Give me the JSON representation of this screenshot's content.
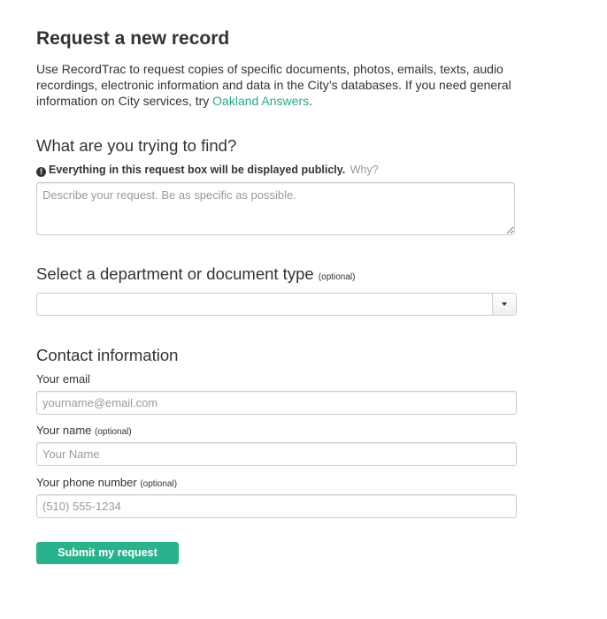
{
  "title": "Request a new record",
  "intro": {
    "text": "Use RecordTrac to request copies of specific documents, photos, emails, texts, audio recordings, electronic information and data in the City’s databases. If you need general information on City services, try ",
    "link_text": "Oakland Answers",
    "trailing": "."
  },
  "find_section": {
    "heading": "What are you trying to find?",
    "warning_icon": "!",
    "warning_text": "Everything in this request box will be displayed publicly.",
    "why_link": "Why?",
    "textarea_placeholder": "Describe your request. Be as specific as possible.",
    "textarea_value": ""
  },
  "department_section": {
    "heading": "Select a department or document type",
    "optional": "(optional)",
    "selected_value": ""
  },
  "contact_section": {
    "heading": "Contact information",
    "email_label": "Your email",
    "email_placeholder": "yourname@email.com",
    "email_value": "",
    "name_label": "Your name",
    "name_optional": "(optional)",
    "name_placeholder": "Your Name",
    "name_value": "",
    "phone_label": "Your phone number",
    "phone_optional": "(optional)",
    "phone_placeholder": "(510) 555-1234",
    "phone_value": ""
  },
  "submit_label": "Submit my request",
  "colors": {
    "accent": "#2ab28d",
    "link": "#2ba68d",
    "text": "#333333",
    "muted": "#999999"
  },
  "icons": {
    "warning": "exclamation-circle-icon",
    "dropdown": "caret-down-icon"
  }
}
